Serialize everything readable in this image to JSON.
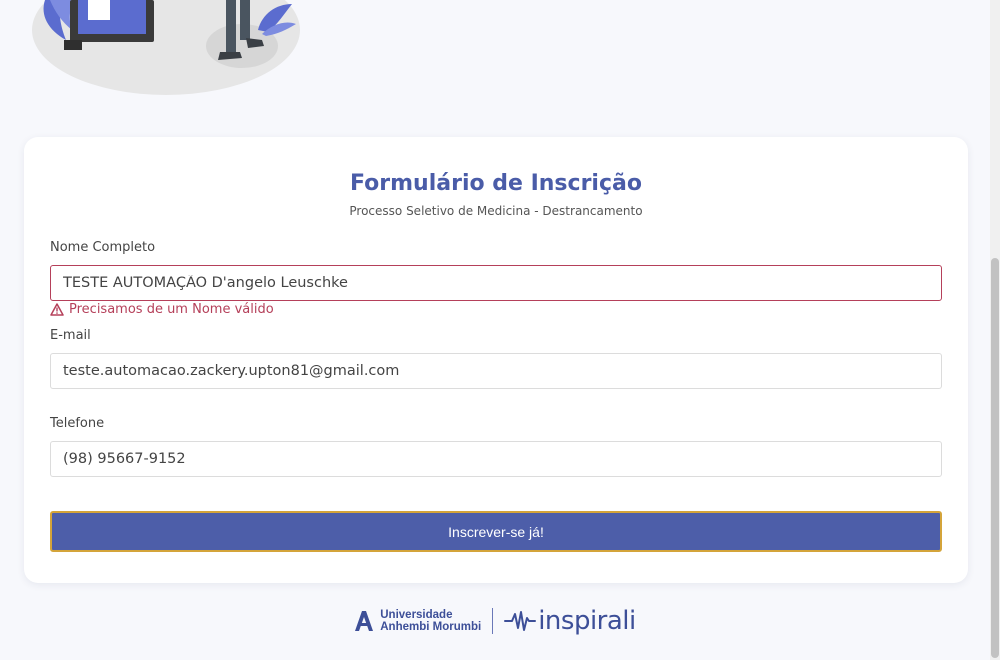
{
  "form": {
    "title": "Formulário de Inscrição",
    "subtitle": "Processo Seletivo de Medicina - Destrancamento",
    "fields": {
      "name": {
        "label": "Nome Completo",
        "value": "TESTE AUTOMAÇÃO D'angelo Leuschke",
        "error": "Precisamos de um Nome válido"
      },
      "email": {
        "label": "E-mail",
        "value": "teste.automacao.zackery.upton81@gmail.com"
      },
      "phone": {
        "label": "Telefone",
        "value": "(98) 95667-9152"
      }
    },
    "submit_label": "Inscrever-se já!"
  },
  "footer": {
    "uam_line1": "Universidade",
    "uam_line2": "Anhembi Morumbi",
    "inspirali": "inspirali"
  },
  "colors": {
    "brand": "#4a5ca8",
    "error": "#b5405a",
    "button_border": "#d4a43a"
  }
}
